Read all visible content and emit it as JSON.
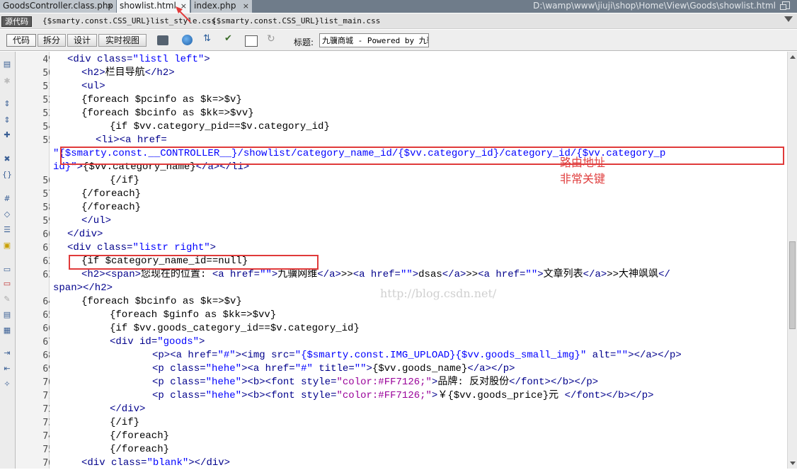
{
  "tabs": [
    {
      "label": "GoodsController.class.php",
      "close": "×"
    },
    {
      "label": "showlist.html",
      "close": "×"
    },
    {
      "label": "index.php",
      "close": "×"
    }
  ],
  "file_path": "D:\\wamp\\www\\jiuji\\shop\\Home\\View\\Goods\\showlist.html",
  "related_files": {
    "source_button": "源代码",
    "files": [
      "{$smarty.const.CSS_URL}list_style.css",
      "{$smarty.const.CSS_URL}list_main.css"
    ]
  },
  "toolbar": {
    "view_buttons": [
      "代码",
      "拆分",
      "设计",
      "实时视图"
    ],
    "title_label": "标题:",
    "title_value": "九骥商城 - Powered by 九骥",
    "icons": [
      "multiscreen-icon",
      "preview-browser-icon",
      "file-management-icon",
      "check-page-icon",
      "visual-aids-icon",
      "refresh-icon"
    ]
  },
  "left_toolbar_icons": [
    "open-documents-icon",
    "collapse-tag-icon",
    "collapse-selection-icon",
    "expand-all-icon",
    "select-parent-tag-icon",
    "balance-braces-icon",
    "line-numbers-icon",
    "highlight-invalid-icon",
    "syntax-coloring-icon",
    "word-wrap-icon",
    "info-icon",
    "apply-comment-icon",
    "remove-comment-icon",
    "wrap-tag-icon",
    "recent-snippets-icon",
    "move-css-icon",
    "indent-icon",
    "outdent-icon",
    "format-source-icon"
  ],
  "line_numbers": [
    "49",
    "50",
    "51",
    "52",
    "53",
    "54",
    "55",
    "",
    "",
    "56",
    "57",
    "58",
    "59",
    "60",
    "61",
    "62",
    "63",
    "",
    "64",
    "65",
    "66",
    "67",
    "68",
    "69",
    "70",
    "71",
    "72",
    "73",
    "74",
    "75",
    "76"
  ],
  "code_lines": [
    [
      {
        "t": "&lt;div ",
        "c": "tg"
      },
      {
        "t": "class=",
        "c": "at"
      },
      {
        "t": "\"listl left\"",
        "c": "sv"
      },
      {
        "t": "&gt;",
        "c": "tg"
      }
    ],
    [
      {
        "t": "&lt;h2&gt;",
        "c": "tg"
      },
      {
        "t": "栏目导航",
        "c": ""
      },
      {
        "t": "&lt;/h2&gt;",
        "c": "tg"
      }
    ],
    [
      {
        "t": "&lt;ul&gt;",
        "c": "tg"
      }
    ],
    [
      {
        "t": "{foreach $pcinfo as $k=&gt;$v}",
        "c": ""
      }
    ],
    [
      {
        "t": "{foreach $bcinfo as $kk=&gt;$vv}",
        "c": ""
      }
    ],
    [
      {
        "t": "{if $vv.category_pid==$v.category_id}",
        "c": ""
      }
    ],
    [
      {
        "t": "&lt;li&gt;&lt;a ",
        "c": "tg"
      },
      {
        "t": "href=",
        "c": "at"
      }
    ],
    [
      {
        "t": "\"{$smarty.const.__CONTROLLER__}/showlist/category_name_id/{$vv.category_id}/category_id/{$vv.category_p",
        "c": "sv"
      }
    ],
    [
      {
        "t": "id}\"",
        "c": "sv"
      },
      {
        "t": "&gt;",
        "c": "tg"
      },
      {
        "t": "{$vv.category_name}",
        "c": ""
      },
      {
        "t": "&lt;/a&gt;&lt;/li&gt;",
        "c": "tg"
      }
    ],
    [
      {
        "t": "{/if}",
        "c": ""
      }
    ],
    [
      {
        "t": "{/foreach}",
        "c": ""
      }
    ],
    [
      {
        "t": "{/foreach}",
        "c": ""
      }
    ],
    [
      {
        "t": "&lt;/ul&gt;",
        "c": "tg"
      }
    ],
    [
      {
        "t": "&lt;/div&gt;",
        "c": "tg"
      }
    ],
    [
      {
        "t": "&lt;div ",
        "c": "tg"
      },
      {
        "t": "class=",
        "c": "at"
      },
      {
        "t": "\"listr right\"",
        "c": "sv"
      },
      {
        "t": "&gt;",
        "c": "tg"
      }
    ],
    [
      {
        "t": "{if $category_name_id==null}",
        "c": ""
      }
    ],
    [
      {
        "t": "&lt;h2&gt;&lt;span&gt;",
        "c": "tg"
      },
      {
        "t": "您现在的位置: ",
        "c": ""
      },
      {
        "t": "&lt;a ",
        "c": "tg"
      },
      {
        "t": "href=",
        "c": "at"
      },
      {
        "t": "\"\"",
        "c": "sv"
      },
      {
        "t": "&gt;",
        "c": "tg"
      },
      {
        "t": "九骥网维",
        "c": ""
      },
      {
        "t": "&lt;/a&gt;",
        "c": "tg"
      },
      {
        "t": "&gt;&gt;",
        "c": ""
      },
      {
        "t": "&lt;a ",
        "c": "tg"
      },
      {
        "t": "href=",
        "c": "at"
      },
      {
        "t": "\"\"",
        "c": "sv"
      },
      {
        "t": "&gt;",
        "c": "tg"
      },
      {
        "t": "dsas",
        "c": ""
      },
      {
        "t": "&lt;/a&gt;",
        "c": "tg"
      },
      {
        "t": "&gt;&gt;",
        "c": ""
      },
      {
        "t": "&lt;a ",
        "c": "tg"
      },
      {
        "t": "href=",
        "c": "at"
      },
      {
        "t": "\"\"",
        "c": "sv"
      },
      {
        "t": "&gt;",
        "c": "tg"
      },
      {
        "t": "文章列表",
        "c": ""
      },
      {
        "t": "&lt;/a&gt;",
        "c": "tg"
      },
      {
        "t": "&gt;&gt;大神飒飒",
        "c": ""
      },
      {
        "t": "&lt;/",
        "c": "tg"
      }
    ],
    [
      {
        "t": "span&gt;&lt;/h2&gt;",
        "c": "tg"
      }
    ],
    [
      {
        "t": "{foreach $bcinfo as $k=&gt;$v}",
        "c": ""
      }
    ],
    [
      {
        "t": "{foreach $ginfo as $kk=&gt;$vv}",
        "c": ""
      }
    ],
    [
      {
        "t": "{if $vv.goods_category_id==$v.category_id}",
        "c": ""
      }
    ],
    [
      {
        "t": "&lt;div ",
        "c": "tg"
      },
      {
        "t": "id=",
        "c": "at"
      },
      {
        "t": "\"goods\"",
        "c": "sv"
      },
      {
        "t": "&gt;",
        "c": "tg"
      }
    ],
    [
      {
        "t": "&lt;p&gt;&lt;a ",
        "c": "tg"
      },
      {
        "t": "href=",
        "c": "at"
      },
      {
        "t": "\"#\"",
        "c": "sv"
      },
      {
        "t": "&gt;&lt;img ",
        "c": "tg"
      },
      {
        "t": "src=",
        "c": "at"
      },
      {
        "t": "\"{$smarty.const.IMG_UPLOAD}{$vv.goods_small_img}\"",
        "c": "sv"
      },
      {
        "t": " alt=",
        "c": "at"
      },
      {
        "t": "\"\"",
        "c": "sv"
      },
      {
        "t": "&gt;&lt;/a&gt;&lt;/p&gt;",
        "c": "tg"
      }
    ],
    [
      {
        "t": "&lt;p ",
        "c": "tg"
      },
      {
        "t": "class=",
        "c": "at"
      },
      {
        "t": "\"hehe\"",
        "c": "sv"
      },
      {
        "t": "&gt;&lt;a ",
        "c": "tg"
      },
      {
        "t": "href=",
        "c": "at"
      },
      {
        "t": "\"#\"",
        "c": "sv"
      },
      {
        "t": " title=",
        "c": "at"
      },
      {
        "t": "\"\"",
        "c": "sv"
      },
      {
        "t": "&gt;",
        "c": "tg"
      },
      {
        "t": "{$vv.goods_name}",
        "c": ""
      },
      {
        "t": "&lt;/a&gt;&lt;/p&gt;",
        "c": "tg"
      }
    ],
    [
      {
        "t": "&lt;p ",
        "c": "tg"
      },
      {
        "t": "class=",
        "c": "at"
      },
      {
        "t": "\"hehe\"",
        "c": "sv"
      },
      {
        "t": "&gt;&lt;b&gt;&lt;font ",
        "c": "tg"
      },
      {
        "t": "style=",
        "c": "at"
      },
      {
        "t": "\"color:#FF7126;\"",
        "c": "ct"
      },
      {
        "t": "&gt;",
        "c": "tg"
      },
      {
        "t": "品牌: 反对股份",
        "c": ""
      },
      {
        "t": "&lt;/font&gt;&lt;/b&gt;&lt;/p&gt;",
        "c": "tg"
      }
    ],
    [
      {
        "t": "&lt;p ",
        "c": "tg"
      },
      {
        "t": "class=",
        "c": "at"
      },
      {
        "t": "\"hehe\"",
        "c": "sv"
      },
      {
        "t": "&gt;&lt;b&gt;&lt;font ",
        "c": "tg"
      },
      {
        "t": "style=",
        "c": "at"
      },
      {
        "t": "\"color:#FF7126;\"",
        "c": "ct"
      },
      {
        "t": "&gt;",
        "c": "tg"
      },
      {
        "t": "￥{$vv.goods_price}元 ",
        "c": ""
      },
      {
        "t": "&lt;/font&gt;&lt;/b&gt;&lt;/p&gt;",
        "c": "tg"
      }
    ],
    [
      {
        "t": "&lt;/div&gt;",
        "c": "tg"
      }
    ],
    [
      {
        "t": "{/if}",
        "c": ""
      }
    ],
    [
      {
        "t": "{/foreach}",
        "c": ""
      }
    ],
    [
      {
        "t": "{/foreach}",
        "c": ""
      }
    ],
    [
      {
        "t": "&lt;div ",
        "c": "tg"
      },
      {
        "t": "class=",
        "c": "at"
      },
      {
        "t": "\"blank\"",
        "c": "sv"
      },
      {
        "t": "&gt;&lt;/div&gt;",
        "c": "tg"
      }
    ]
  ],
  "annotation": {
    "line1": "路由地址",
    "line2": "非常关键"
  },
  "watermark": "http://blog.csdn.net/",
  "colors": {
    "tag": "#00008b",
    "string": "#0000ff",
    "highlight": "#e03a3a",
    "annotation": "#e04040"
  }
}
